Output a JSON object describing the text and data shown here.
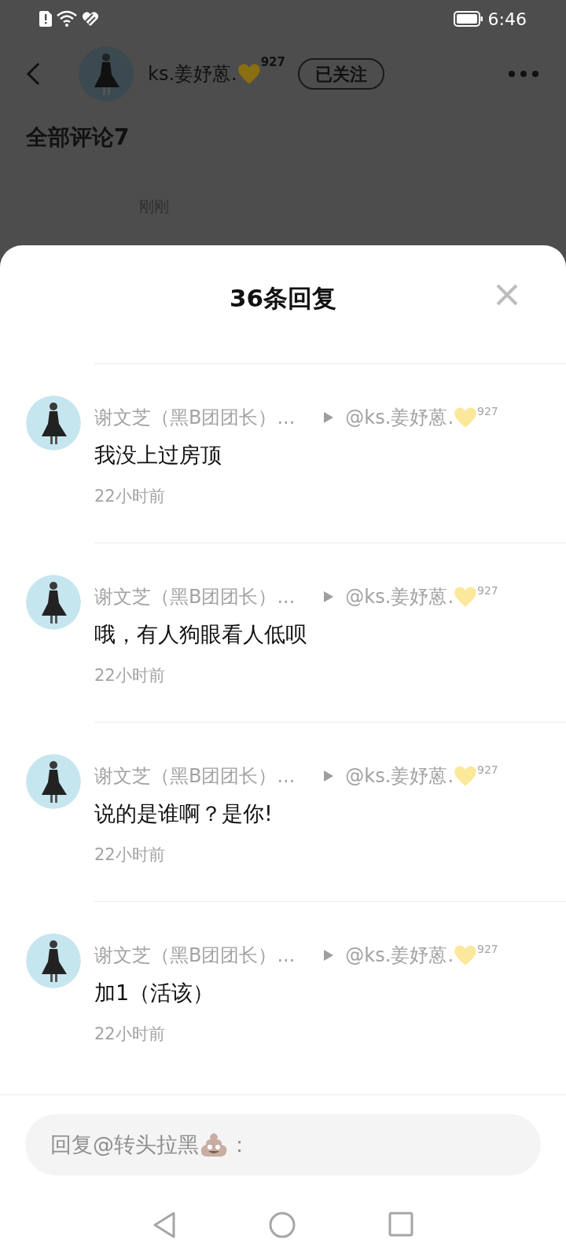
{
  "status_bar": {
    "time": "6:46"
  },
  "header": {
    "user_name": "ks.姜妤蒽.",
    "user_level": "927",
    "follow_button": "已关注"
  },
  "background": {
    "section_title": "全部评论7",
    "time": "刚刚"
  },
  "sheet": {
    "title": "36条回复",
    "replies": [
      {
        "author": "谢文芝（黑B团团长）...",
        "reply_to": "@ks.姜妤蒽.",
        "reply_to_level": "927",
        "text": "我没上过房顶",
        "time": "22小时前"
      },
      {
        "author": "谢文芝（黑B团团长）...",
        "reply_to": "@ks.姜妤蒽.",
        "reply_to_level": "927",
        "text": "哦，有人狗眼看人低呗",
        "time": "22小时前"
      },
      {
        "author": "谢文芝（黑B团团长）...",
        "reply_to": "@ks.姜妤蒽.",
        "reply_to_level": "927",
        "text": "说的是谁啊？是你!",
        "time": "22小时前"
      },
      {
        "author": "谢文芝（黑B团团长）...",
        "reply_to": "@ks.姜妤蒽.",
        "reply_to_level": "927",
        "text": "加1（活该）",
        "time": "22小时前"
      }
    ]
  },
  "reply_input": {
    "placeholder": "回复@转头拉黑",
    "placeholder_suffix": "："
  }
}
